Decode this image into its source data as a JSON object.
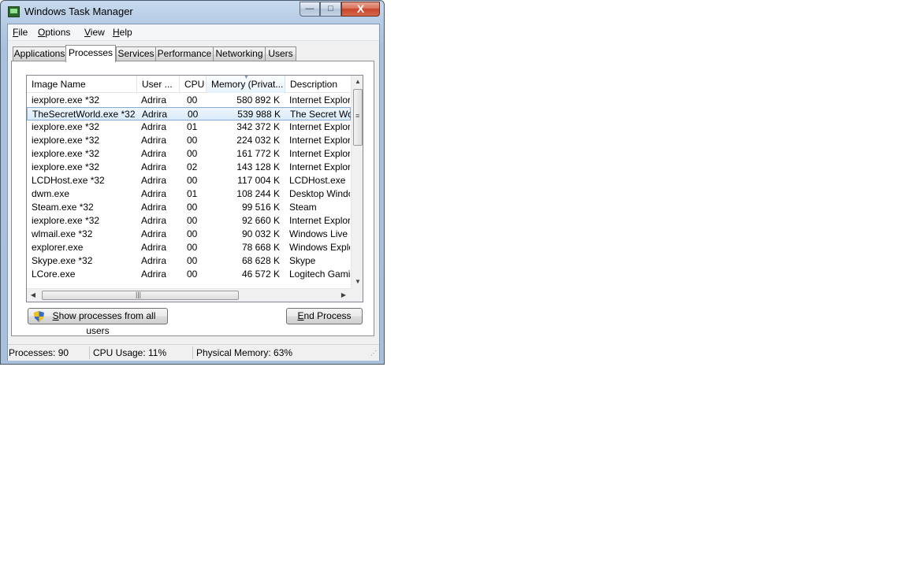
{
  "window": {
    "title": "Windows Task Manager"
  },
  "controls": {
    "minimize": "—",
    "maximize": "□",
    "close": "X"
  },
  "menu": [
    {
      "acc": "F",
      "rest": "ile"
    },
    {
      "acc": "O",
      "rest": "ptions"
    },
    {
      "acc": "V",
      "rest": "iew"
    },
    {
      "acc": "H",
      "rest": "elp"
    }
  ],
  "tabs": [
    "Applications",
    "Processes",
    "Services",
    "Performance",
    "Networking",
    "Users"
  ],
  "active_tab": "Processes",
  "columns": [
    "Image Name",
    "User ...",
    "CPU",
    "Memory (Privat...",
    "Description"
  ],
  "sorted_column": "Memory (Privat...",
  "processes": [
    {
      "name": "iexplore.exe *32",
      "user": "Adrira",
      "cpu": "00",
      "memory": "580 892 K",
      "description": "Internet Explorer"
    },
    {
      "name": "TheSecretWorld.exe *32",
      "user": "Adrira",
      "cpu": "00",
      "memory": "539 988 K",
      "description": "The Secret World"
    },
    {
      "name": "iexplore.exe *32",
      "user": "Adrira",
      "cpu": "01",
      "memory": "342 372 K",
      "description": "Internet Explorer"
    },
    {
      "name": "iexplore.exe *32",
      "user": "Adrira",
      "cpu": "00",
      "memory": "224 032 K",
      "description": "Internet Explorer"
    },
    {
      "name": "iexplore.exe *32",
      "user": "Adrira",
      "cpu": "00",
      "memory": "161 772 K",
      "description": "Internet Explorer"
    },
    {
      "name": "iexplore.exe *32",
      "user": "Adrira",
      "cpu": "02",
      "memory": "143 128 K",
      "description": "Internet Explorer"
    },
    {
      "name": "LCDHost.exe *32",
      "user": "Adrira",
      "cpu": "00",
      "memory": "117 004 K",
      "description": "LCDHost.exe"
    },
    {
      "name": "dwm.exe",
      "user": "Adrira",
      "cpu": "01",
      "memory": "108 244 K",
      "description": "Desktop Window Manager"
    },
    {
      "name": "Steam.exe *32",
      "user": "Adrira",
      "cpu": "00",
      "memory": "99 516 K",
      "description": "Steam"
    },
    {
      "name": "iexplore.exe *32",
      "user": "Adrira",
      "cpu": "00",
      "memory": "92 660 K",
      "description": "Internet Explorer"
    },
    {
      "name": "wlmail.exe *32",
      "user": "Adrira",
      "cpu": "00",
      "memory": "90 032 K",
      "description": "Windows Live Mail"
    },
    {
      "name": "explorer.exe",
      "user": "Adrira",
      "cpu": "00",
      "memory": "78 668 K",
      "description": "Windows Explorer"
    },
    {
      "name": "Skype.exe *32",
      "user": "Adrira",
      "cpu": "00",
      "memory": "68 628 K",
      "description": "Skype"
    },
    {
      "name": "LCore.exe",
      "user": "Adrira",
      "cpu": "00",
      "memory": "46 572 K",
      "description": "Logitech Gaming"
    }
  ],
  "selected_row": 1,
  "buttons": {
    "show_all": {
      "acc": "S",
      "rest": "how processes from all users"
    },
    "end_process": {
      "acc": "E",
      "rest": "nd Process"
    }
  },
  "status": {
    "processes": "Processes: 90",
    "cpu": "CPU Usage: 11%",
    "memory": "Physical Memory: 63%"
  }
}
